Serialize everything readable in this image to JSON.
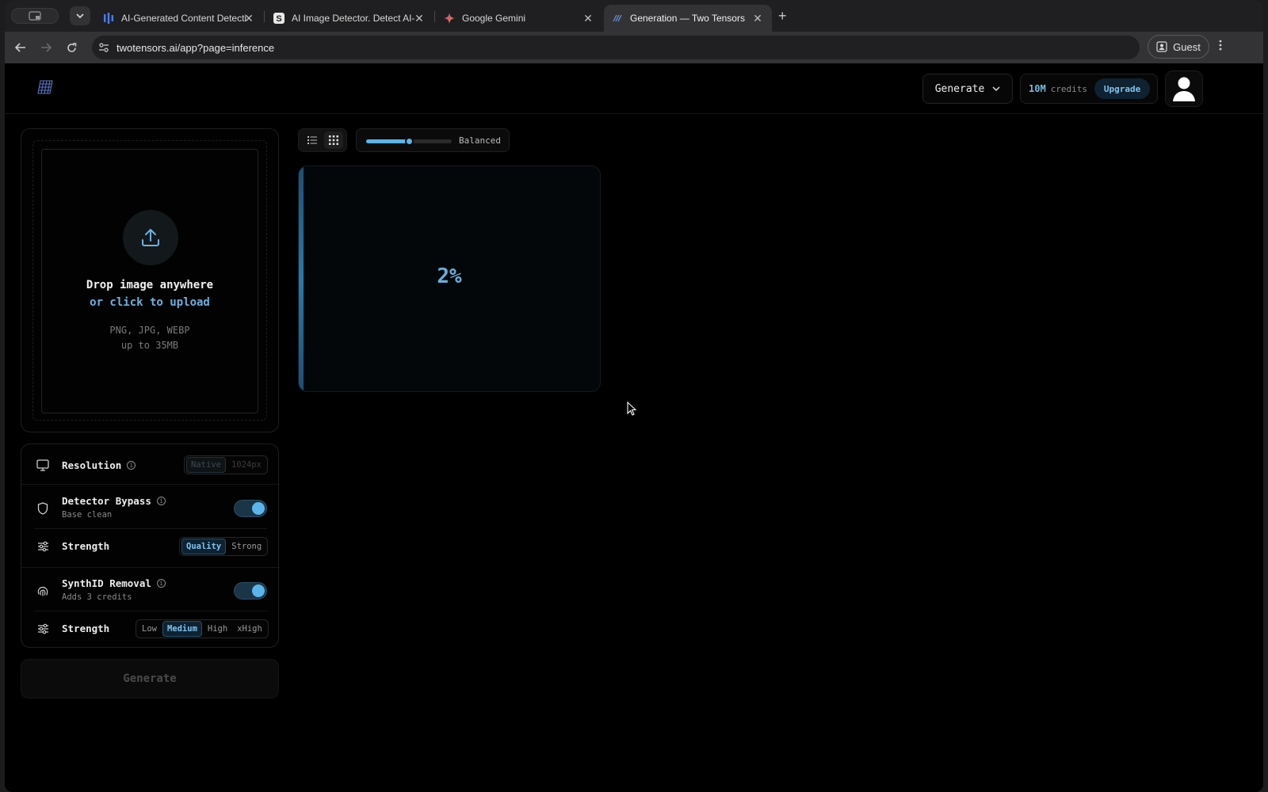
{
  "browser": {
    "tabs": [
      {
        "title": "AI-Generated Content Detecti",
        "icon": "bars-icon",
        "active": false
      },
      {
        "title": "AI Image Detector. Detect AI-",
        "icon": "s-logo-icon",
        "active": false
      },
      {
        "title": "Google Gemini",
        "icon": "gemini-sparkle-icon",
        "active": false
      },
      {
        "title": "Generation — Two Tensors",
        "icon": "two-tensors-icon",
        "active": true
      }
    ],
    "close_glyph": "✕",
    "new_tab_glyph": "+",
    "url": "twotensors.ai/app?page=inference",
    "profile_label": "Guest"
  },
  "header": {
    "generate_menu_label": "Generate",
    "credits_amount": "10M",
    "credits_label": "credits",
    "upgrade_label": "Upgrade"
  },
  "upload": {
    "title": "Drop image anywhere",
    "link": "or click to upload",
    "formats": "PNG, JPG, WEBP",
    "size_limit": "up to 35MB"
  },
  "settings": {
    "resolution": {
      "label": "Resolution",
      "options": [
        "Native",
        "1024px"
      ],
      "selected": "Native",
      "disabled": true
    },
    "detector_bypass": {
      "label": "Detector Bypass",
      "sub": "Base clean",
      "enabled": true
    },
    "bypass_strength": {
      "label": "Strength",
      "options": [
        "Quality",
        "Strong"
      ],
      "selected": "Quality"
    },
    "synthid": {
      "label": "SynthID Removal",
      "sub": "Adds 3 credits",
      "enabled": true
    },
    "synthid_strength": {
      "label": "Strength",
      "options": [
        "Low",
        "Medium",
        "High",
        "xHigh"
      ],
      "selected": "Medium"
    }
  },
  "generate_button_label": "Generate",
  "view": {
    "modes": [
      "list",
      "grid"
    ],
    "active_mode": "grid",
    "balance_label": "Balanced",
    "balance_level": 0.5
  },
  "generation": {
    "progress_text": "2%",
    "progress": 0.02
  },
  "colors": {
    "accent": "#5ab6ea",
    "link": "#6fb1e0",
    "background": "#000000"
  }
}
